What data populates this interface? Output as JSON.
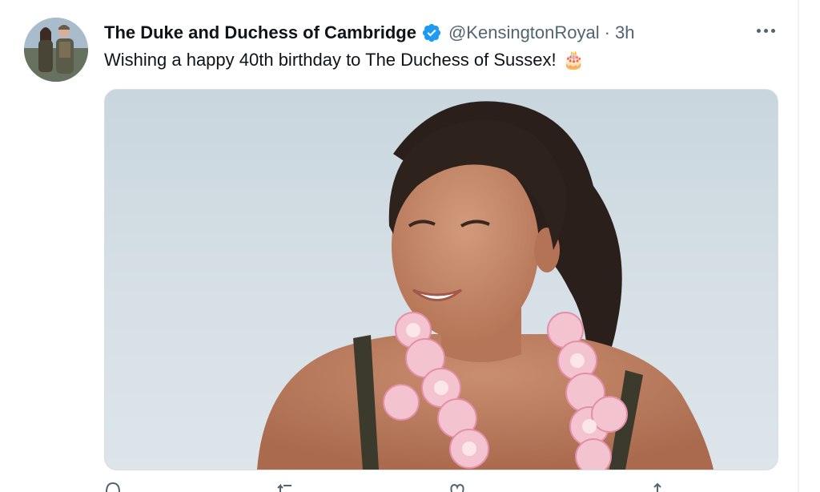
{
  "tweet": {
    "author_name": "The Duke and Duchess of Cambridge",
    "verified": true,
    "handle": "@KensingtonRoyal",
    "separator": "·",
    "time": "3h",
    "text": "Wishing a happy 40th birthday to The Duchess of Sussex!",
    "emoji": "🎂",
    "media_alt": "Photo of a smiling woman wearing a pink and white flower lei"
  },
  "icons": {
    "verified": "verified-badge-icon",
    "more": "more-options-icon",
    "reply": "reply-icon",
    "retweet": "retweet-icon",
    "like": "like-icon",
    "share": "share-icon"
  },
  "colors": {
    "verified": "#1d9bf0",
    "secondary_text": "#536471",
    "primary_text": "#0f1419"
  }
}
